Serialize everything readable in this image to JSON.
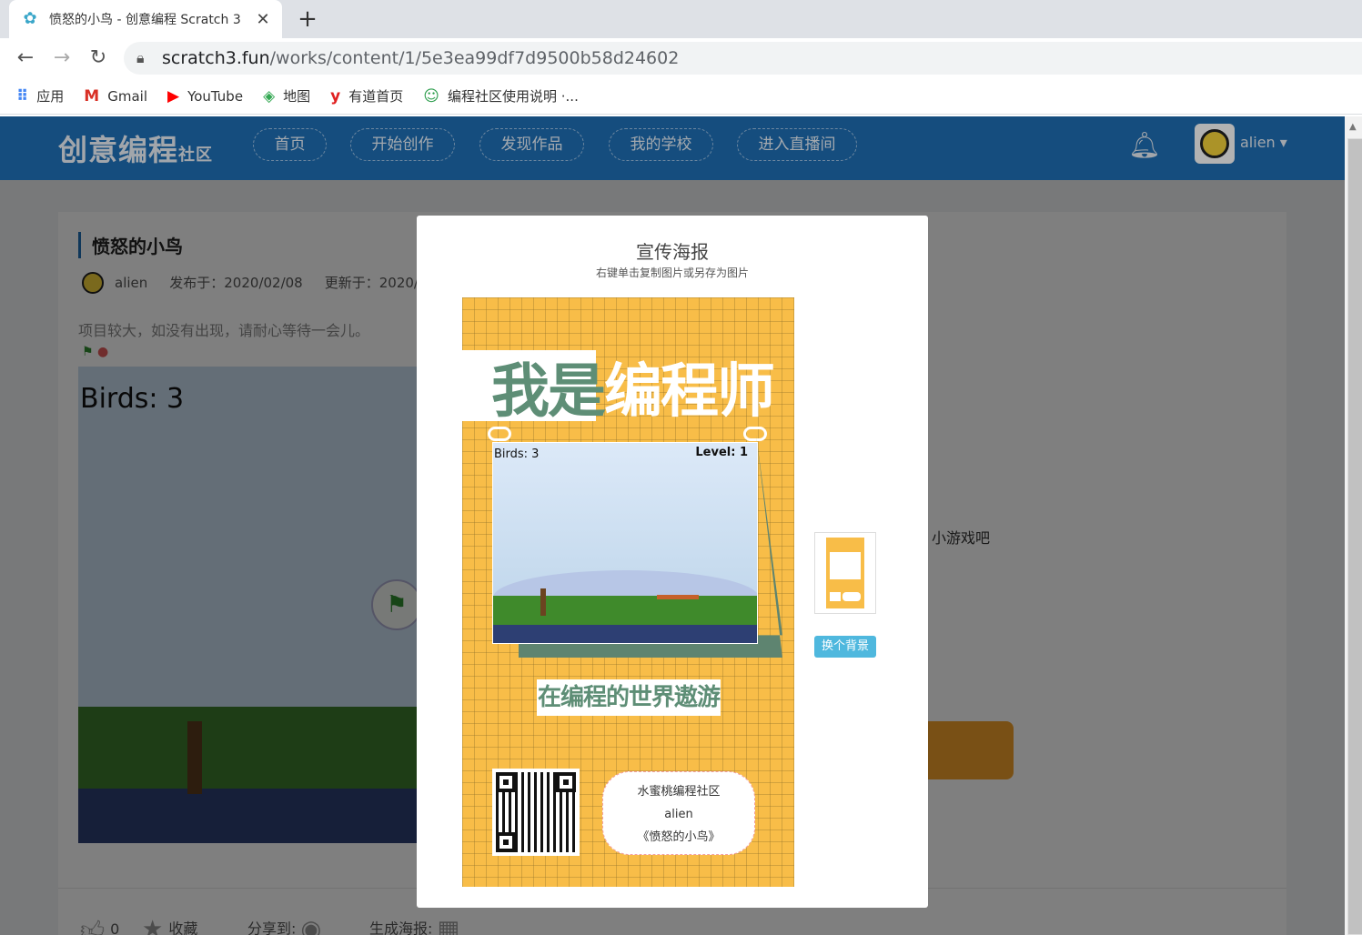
{
  "browser": {
    "tab_title": "愤怒的小鸟 - 创意编程 Scratch 3",
    "new_tab": "+",
    "close": "✕",
    "url_host": "scratch3.fun",
    "url_path": "/works/content/1/5e3ea99df7d9500b58d24602",
    "bookmarks": [
      {
        "label": "应用",
        "icon": "apps-grid-icon"
      },
      {
        "label": "Gmail",
        "icon": "gmail-icon"
      },
      {
        "label": "YouTube",
        "icon": "youtube-icon"
      },
      {
        "label": "地图",
        "icon": "maps-icon"
      },
      {
        "label": "有道首页",
        "icon": "youdao-icon"
      },
      {
        "label": "编程社区使用说明 ·...",
        "icon": "community-icon"
      }
    ]
  },
  "site": {
    "logo": "创意编程",
    "logo_suffix": "社区",
    "nav": [
      "首页",
      "开始创作",
      "发现作品",
      "我的学校",
      "进入直播间"
    ],
    "user": "alien"
  },
  "project": {
    "title": "愤怒的小鸟",
    "author": "alien",
    "published": "发布于：2020/02/08",
    "updated": "更新于：2020/02",
    "hint": "项目较大，如没有出现，请耐心等待一会儿。",
    "stage_text": "Birds: 3",
    "side_text": "小游戏吧",
    "likes": "0",
    "favorite": "收藏",
    "share": "分享到:",
    "poster_gen": "生成海报:"
  },
  "modal": {
    "title": "宣传海报",
    "subtitle": "右键单击复制图片或另存为图片",
    "poster": {
      "banner_a": "我是",
      "banner_b": "编程师",
      "birds": "Birds: 3",
      "level": "Level:  1",
      "slogan": "在编程的世界遨游",
      "community": "水蜜桃编程社区",
      "author": "alien",
      "work": "《愤怒的小鸟》"
    },
    "change_bg": "换个背景"
  },
  "colors": {
    "header": "#1f6fb5",
    "poster_bg": "#f8bd48",
    "poster_green": "#5e8e76",
    "button_blue": "#4fb8de"
  }
}
